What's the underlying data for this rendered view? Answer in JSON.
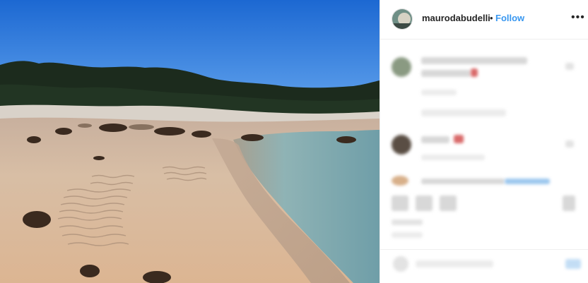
{
  "post": {
    "username": "maurodabudelli",
    "separator": "•",
    "follow_label": "Follow",
    "more_icon": "more-icon",
    "more_glyph": "•••"
  },
  "photo": {
    "subject": "beach-photo",
    "colors": {
      "sky_top": "#1f6fd6",
      "sky_bottom": "#5aa0ee",
      "trees": "#1a2a1c",
      "sand": "#d7b79d",
      "water": "#8fb7bd"
    }
  },
  "comments": {
    "state": "blurred"
  }
}
